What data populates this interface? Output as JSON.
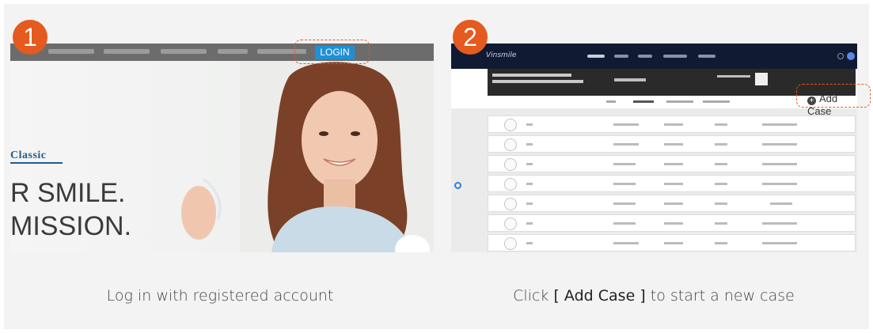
{
  "steps": [
    {
      "number": "1",
      "caption": "Log in with registered account",
      "screenshot": {
        "nav_button": "LOGIN",
        "brand_text": "Classic",
        "headline_1": "R SMILE.",
        "headline_2": "MISSION.",
        "slider_text": ">"
      }
    },
    {
      "number": "2",
      "caption_prefix": "Click ",
      "caption_highlight": "[ Add Case ]",
      "caption_suffix": " to start a new case",
      "screenshot": {
        "logo_text": "Vinsmile",
        "add_case_label": "Add Case",
        "add_case_icon": "plus-circle-icon"
      }
    }
  ],
  "colors": {
    "badge": "#e45a1f",
    "highlight_outline": "#e45a1f",
    "login_button": "#1f8fd6",
    "app_navbar": "#101a33"
  }
}
